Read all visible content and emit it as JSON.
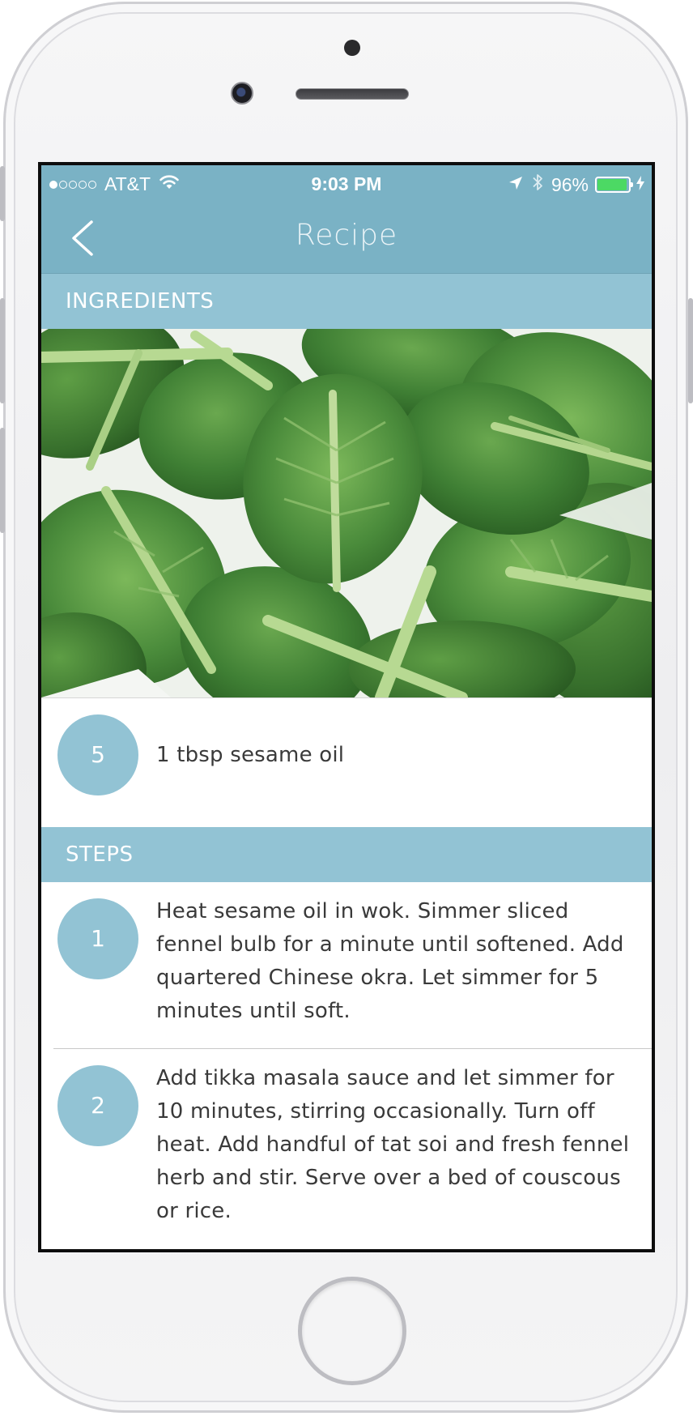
{
  "status_bar": {
    "carrier": "AT&T",
    "signal_bars_filled": 1,
    "signal_bars_total": 5,
    "time": "9:03 PM",
    "battery_percent": "96%",
    "battery_level": 0.96,
    "icons": [
      "wifi-icon",
      "location-arrow-icon",
      "bluetooth-icon",
      "charging-bolt-icon"
    ]
  },
  "nav": {
    "title": "Recipe",
    "back_icon": "chevron-left-icon"
  },
  "ingredients": {
    "header": "INGREDIENTS",
    "image": "bok-choy-leaves-photo",
    "items": [
      {
        "number": "5",
        "text": "1 tbsp sesame oil"
      }
    ]
  },
  "steps": {
    "header": "STEPS",
    "items": [
      {
        "number": "1",
        "text": "Heat sesame oil in wok. Simmer sliced fennel bulb for a minute until softened. Add quartered Chinese okra. Let simmer for 5 minutes until soft."
      },
      {
        "number": "2",
        "text": "Add tikka masala sauce and let simmer for 10 minutes, stirring occasionally. Turn off heat. Add handful of tat soi and fresh fennel herb and stir. Serve over a bed of couscous or rice."
      }
    ]
  },
  "colors": {
    "nav_bar": "#7ab2c5",
    "section_header": "#92c3d4",
    "badge": "#92c3d4",
    "battery": "#4cd964"
  }
}
